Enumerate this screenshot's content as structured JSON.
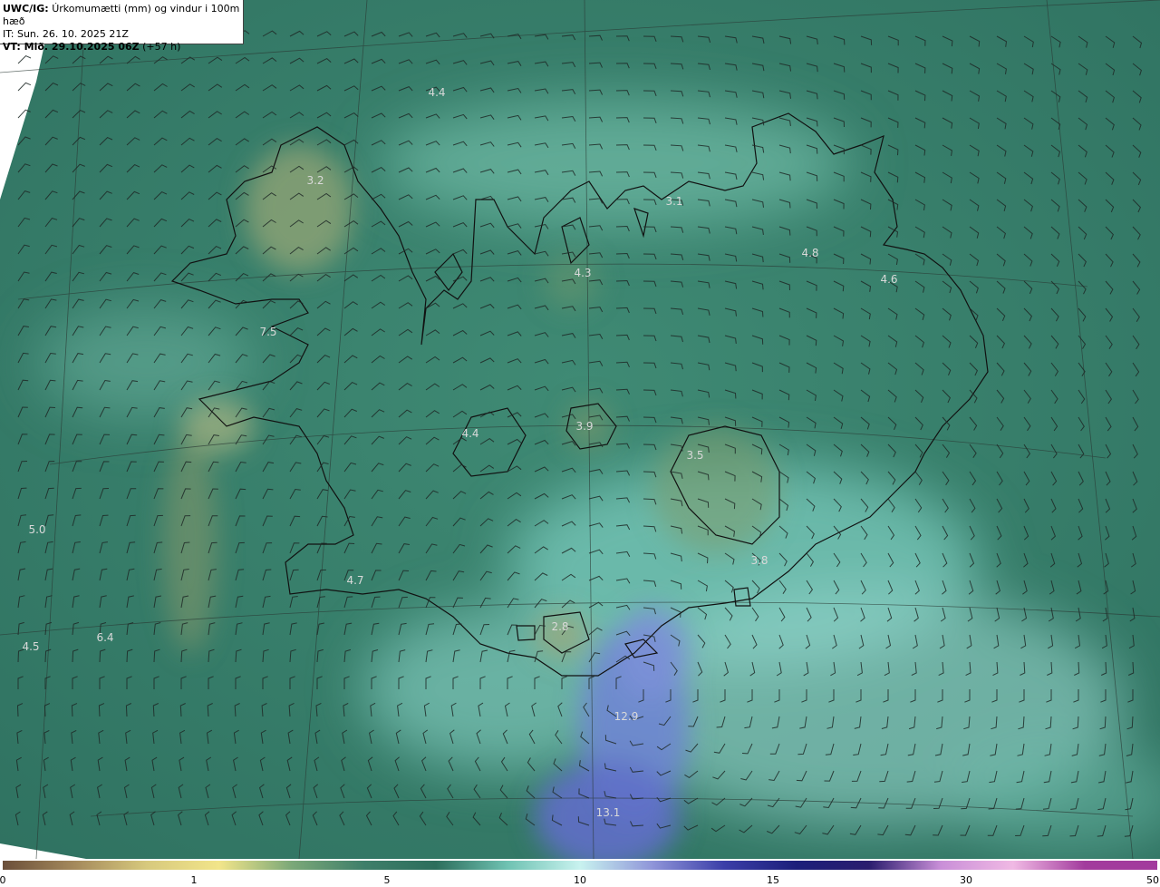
{
  "header": {
    "product": "UWC/IG:",
    "title": "Úrkomumætti (mm) og vindur i 100m hæð",
    "it_line": "IT: Sun. 26. 10. 2025 21Z",
    "vt_prefix": "VT: Mið. 29.10.2025 06Z",
    "vt_suffix": "(+57 h)"
  },
  "map_labels": [
    "4.4",
    "3.2",
    "3.1",
    "4.3",
    "4.8",
    "4.6",
    "7.5",
    "3.9",
    "4.4",
    "3.5",
    "5.0",
    "4.7",
    "3.8",
    "2.8",
    "4.5",
    "6.4",
    "12.9",
    "13.1"
  ],
  "colorbar": {
    "ticks": [
      "0",
      "1",
      "5",
      "10",
      "15",
      "30",
      "50"
    ],
    "colors": [
      "#6b4f3a",
      "#a58a5c",
      "#d7c97d",
      "#f2e58a",
      "#7ba878",
      "#3f7f6a",
      "#2c6e5c",
      "#6fc2b2",
      "#c8f2ef",
      "#8f95d9",
      "#3b3ea8",
      "#1c1f7a",
      "#2a1d6e",
      "#c98fd8",
      "#f0b9e4",
      "#a23b9d"
    ]
  }
}
